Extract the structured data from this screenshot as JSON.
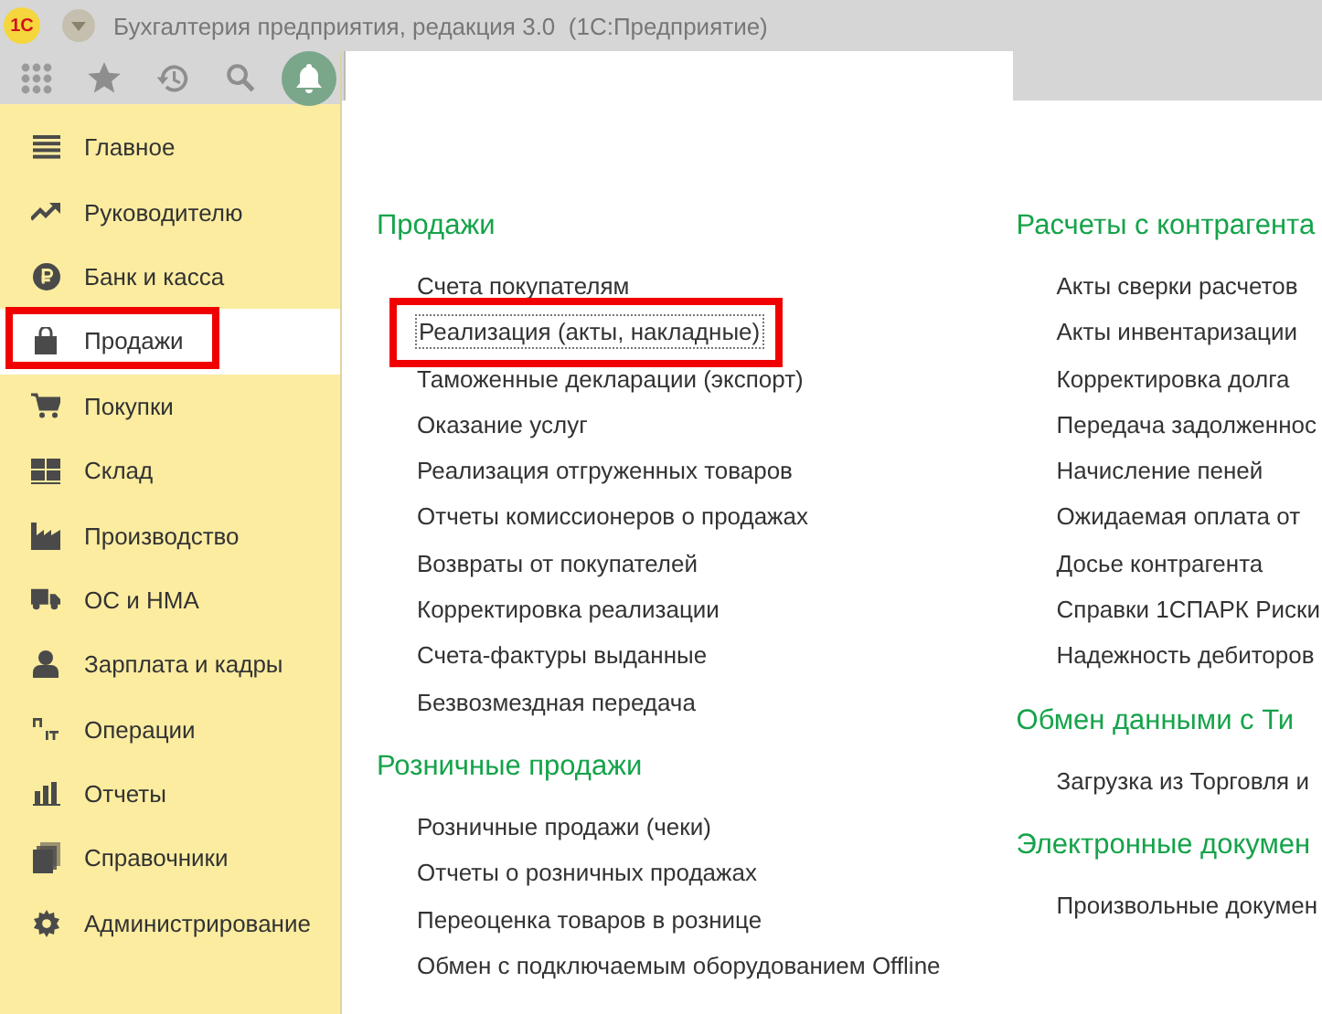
{
  "window": {
    "logo": "1С",
    "title": "Бухгалтерия предприятия, редакция 3.0  (1С:Предприятие)"
  },
  "sidebar": {
    "items": [
      {
        "label": "Главное",
        "selected": false,
        "highlighted": false
      },
      {
        "label": "Руководителю",
        "selected": false,
        "highlighted": false
      },
      {
        "label": "Банк и касса",
        "selected": false,
        "highlighted": false
      },
      {
        "label": "Продажи",
        "selected": true,
        "highlighted": true
      },
      {
        "label": "Покупки",
        "selected": false,
        "highlighted": false
      },
      {
        "label": "Склад",
        "selected": false,
        "highlighted": false
      },
      {
        "label": "Производство",
        "selected": false,
        "highlighted": false
      },
      {
        "label": "ОС и НМА",
        "selected": false,
        "highlighted": false
      },
      {
        "label": "Зарплата и кадры",
        "selected": false,
        "highlighted": false
      },
      {
        "label": "Операции",
        "selected": false,
        "highlighted": false
      },
      {
        "label": "Отчеты",
        "selected": false,
        "highlighted": false
      },
      {
        "label": "Справочники",
        "selected": false,
        "highlighted": false
      },
      {
        "label": "Администрирование",
        "selected": false,
        "highlighted": false
      }
    ]
  },
  "columns": [
    [
      {
        "title": "Продажи",
        "items": [
          {
            "label": "Счета покупателям",
            "highlighted": false
          },
          {
            "label": "Реализация (акты, накладные)",
            "highlighted": true
          },
          {
            "label": "Таможенные декларации (экспорт)",
            "highlighted": false
          },
          {
            "label": "Оказание услуг",
            "highlighted": false
          },
          {
            "label": "Реализация отгруженных товаров",
            "highlighted": false
          },
          {
            "label": "Отчеты комиссионеров о продажах",
            "highlighted": false
          },
          {
            "label": "Возвраты от покупателей",
            "highlighted": false
          },
          {
            "label": "Корректировка реализации",
            "highlighted": false
          },
          {
            "label": "Счета-фактуры выданные",
            "highlighted": false
          },
          {
            "label": "Безвозмездная передача",
            "highlighted": false
          }
        ]
      },
      {
        "title": "Розничные продажи",
        "items": [
          {
            "label": "Розничные продажи (чеки)",
            "highlighted": false
          },
          {
            "label": "Отчеты о розничных продажах",
            "highlighted": false
          },
          {
            "label": "Переоценка товаров в рознице",
            "highlighted": false
          },
          {
            "label": "Обмен с подключаемым оборудованием Offline",
            "highlighted": false
          }
        ]
      }
    ],
    [
      {
        "title": "Расчеты с контрагента",
        "items": [
          {
            "label": "Акты сверки расчетов",
            "highlighted": false
          },
          {
            "label": "Акты инвентаризации",
            "highlighted": false
          },
          {
            "label": "Корректировка долга",
            "highlighted": false
          },
          {
            "label": "Передача задолженнос",
            "highlighted": false
          },
          {
            "label": "Начисление пеней",
            "highlighted": false
          },
          {
            "label": "Ожидаемая оплата от",
            "highlighted": false
          },
          {
            "label": "Досье контрагента",
            "highlighted": false
          },
          {
            "label": "Справки 1СПАРК Риски",
            "highlighted": false
          },
          {
            "label": "Надежность дебиторов",
            "highlighted": false
          }
        ]
      },
      {
        "title": "Обмен данными с Ти",
        "items": [
          {
            "label": "Загрузка из Торговля и",
            "highlighted": false
          }
        ]
      },
      {
        "title": "Электронные докумен",
        "items": [
          {
            "label": "Произвольные докумен",
            "highlighted": false
          }
        ]
      }
    ]
  ]
}
